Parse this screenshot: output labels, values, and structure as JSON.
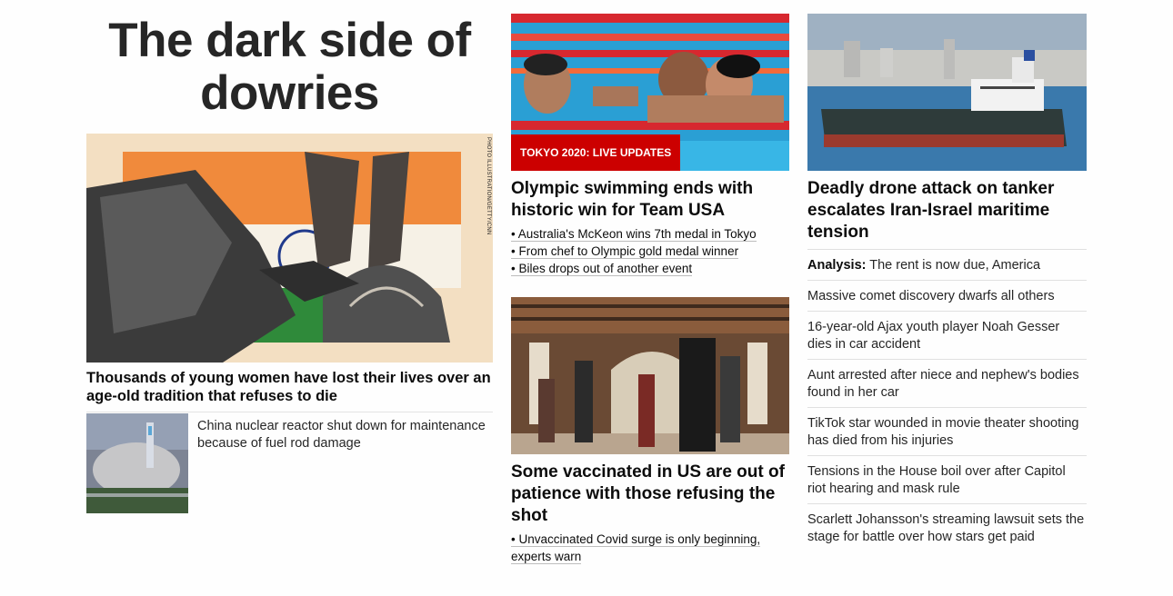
{
  "col1": {
    "hero_title": "The dark side of dowries",
    "hero_photo_credit": "PHOTO ILLUSTRATION/GETTY/CNN",
    "hero_caption": "Thousands of young women have lost their lives over an age-old tradition that refuses to die",
    "thumb_story": "China nuclear reactor shut down for maintenance because of fuel rod damage"
  },
  "col2": {
    "badge": "TOKYO 2020: LIVE UPDATES",
    "headline1": "Olympic swimming ends with historic win for Team USA",
    "bullets1": [
      "• Australia's McKeon wins 7th medal in Tokyo",
      "• From chef to Olympic gold medal winner",
      "• Biles drops out of another event"
    ],
    "headline2": "Some vaccinated in US are out of patience with those refusing the shot",
    "bullets2": [
      "• Unvaccinated Covid surge is only beginning, experts warn"
    ]
  },
  "col3": {
    "headline": "Deadly drone attack on tanker escalates Iran-Israel maritime tension",
    "analysis_label": "Analysis:",
    "analysis_text": " The rent is now due, America",
    "stories": [
      "Massive comet discovery dwarfs all others",
      "16-year-old Ajax youth player Noah Gesser dies in car accident",
      "Aunt arrested after niece and nephew's bodies found in her car",
      "TikTok star wounded in movie theater shooting has died from his injuries",
      "Tensions in the House boil over after Capitol riot hearing and mask rule",
      "Scarlett Johansson's streaming lawsuit sets the stage for battle over how stars get paid"
    ]
  },
  "colors": {
    "badge_red": "#cc0000",
    "text": "#0c0c0c",
    "divider": "#e0e0e0"
  }
}
